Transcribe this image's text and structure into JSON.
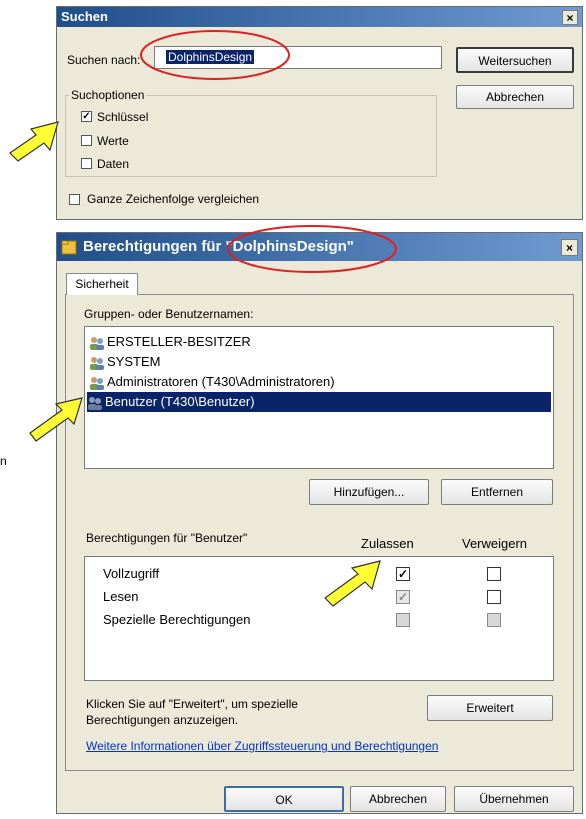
{
  "search_dialog": {
    "title": "Suchen",
    "close_glyph": "×",
    "search_label": "Suchen nach:",
    "search_value": "DolphinsDesign",
    "find_next_button": "Weitersuchen",
    "cancel_button": "Abbrechen",
    "options_group": "Suchoptionen",
    "options": [
      {
        "label": "Schlüssel",
        "checked": true
      },
      {
        "label": "Werte",
        "checked": false
      },
      {
        "label": "Daten",
        "checked": false
      }
    ],
    "whole_string": {
      "label": "Ganze Zeichenfolge vergleichen",
      "checked": false
    }
  },
  "perm_dialog": {
    "title": "Berechtigungen für \"DolphinsDesign\"",
    "close_glyph": "×",
    "tab": "Sicherheit",
    "groups_label": "Gruppen- oder Benutzernamen:",
    "principals": [
      {
        "name": "ERSTELLER-BESITZER",
        "selected": false
      },
      {
        "name": "SYSTEM",
        "selected": false
      },
      {
        "name": "Administratoren (T430\\Administratoren)",
        "selected": false
      },
      {
        "name": "Benutzer (T430\\Benutzer)",
        "selected": true
      }
    ],
    "add_button": "Hinzufügen...",
    "remove_button": "Entfernen",
    "perms_for_label": "Berechtigungen für \"Benutzer\"",
    "allow_header": "Zulassen",
    "deny_header": "Verweigern",
    "permissions": [
      {
        "name": "Vollzugriff",
        "allow": "checked",
        "deny": "unchecked"
      },
      {
        "name": "Lesen",
        "allow": "checked-disabled",
        "deny": "unchecked"
      },
      {
        "name": "Spezielle Berechtigungen",
        "allow": "disabled",
        "deny": "disabled"
      }
    ],
    "advanced_hint": "Klicken Sie auf \"Erweitert\", um spezielle Berechtigungen anzuzeigen.",
    "advanced_button": "Erweitert",
    "info_link": "Weitere Informationen über Zugriffssteuerung und Berechtigungen",
    "ok_button": "OK",
    "cancel_button": "Abbrechen",
    "apply_button": "Übernehmen"
  },
  "stray_text": "n",
  "colors": {
    "highlight_ring": "#e02020",
    "arrow_fill": "#ffff33",
    "selection": "#0a246a",
    "link": "#0033cc"
  }
}
